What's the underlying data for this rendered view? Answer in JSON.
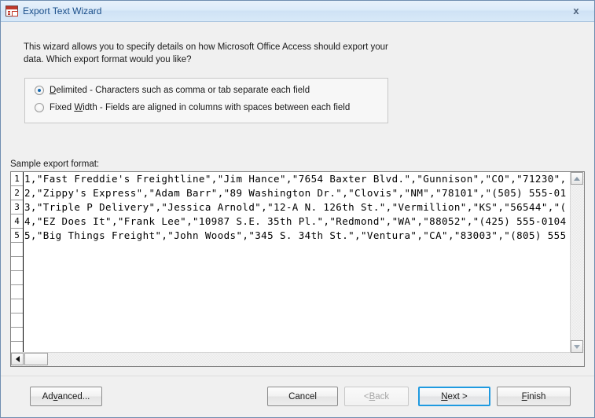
{
  "window": {
    "title": "Export Text Wizard",
    "icon": "export-text-wizard-icon",
    "close_label": "x"
  },
  "intro": {
    "text": "This wizard allows you to specify details on how Microsoft Office Access should export your data. Which export format would you like?"
  },
  "format_options": {
    "selected": "delimited",
    "items": [
      {
        "id": "delimited",
        "accel": "D",
        "label_before": "",
        "label_accel": "D",
        "label_after": "elimited - Characters such as comma or tab separate each field",
        "checked": true
      },
      {
        "id": "fixed_width",
        "accel": "W",
        "label_before": "Fixed ",
        "label_accel": "W",
        "label_after": "idth - Fields are aligned in columns with spaces between each field",
        "checked": false
      }
    ]
  },
  "sample": {
    "label": "Sample export format:",
    "row_numbers": [
      "1",
      "2",
      "3",
      "4",
      "5"
    ],
    "rows": [
      "1,\"Fast Freddie's Freightline\",\"Jim Hance\",\"7654 Baxter Blvd.\",\"Gunnison\",\"CO\",\"71230\",",
      "2,\"Zippy's Express\",\"Adam Barr\",\"89 Washington Dr.\",\"Clovis\",\"NM\",\"78101\",\"(505) 555-01",
      "3,\"Triple P Delivery\",\"Jessica Arnold\",\"12-A N. 126th St.\",\"Vermillion\",\"KS\",\"56544\",\"(",
      "4,\"EZ Does It\",\"Frank Lee\",\"10987 S.E. 35th Pl.\",\"Redmond\",\"WA\",\"88052\",\"(425) 555-0104",
      "5,\"Big Things Freight\",\"John Woods\",\"345 S. 34th St.\",\"Ventura\",\"CA\",\"83003\",\"(805) 555"
    ],
    "scrollbar": {
      "up_icon": "scroll-up-arrow-icon",
      "down_icon": "scroll-down-arrow-icon",
      "left_icon": "scroll-left-arrow-icon",
      "right_icon": "scroll-right-arrow-icon"
    }
  },
  "footer": {
    "advanced": {
      "before": "Ad",
      "accel": "v",
      "after": "anced...",
      "enabled": true
    },
    "cancel": {
      "before": "Cancel",
      "accel": "",
      "after": "",
      "enabled": true
    },
    "back": {
      "before": "< ",
      "accel": "B",
      "after": "ack",
      "enabled": false
    },
    "next": {
      "before": "",
      "accel": "N",
      "after": "ext >",
      "enabled": true,
      "is_default": true
    },
    "finish": {
      "before": "",
      "accel": "F",
      "after": "inish",
      "enabled": true
    }
  },
  "colors": {
    "accent": "#1f9ae0",
    "title_text": "#1b4f8a",
    "radio_dot": "#1569b0"
  }
}
